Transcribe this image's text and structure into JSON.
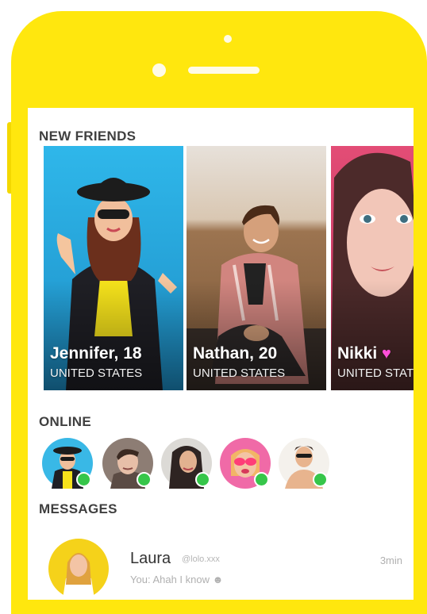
{
  "sections": {
    "new_friends": "NEW FRIENDS",
    "online": "ONLINE",
    "messages": "MESSAGES"
  },
  "new_friends": [
    {
      "name": "Jennifer, 18",
      "country": "UNITED STATES"
    },
    {
      "name": "Nathan, 20",
      "country": "UNITED STATES"
    },
    {
      "name": "Nikki",
      "country": "UNITED STATES",
      "icon": "heart-icon"
    }
  ],
  "online_users": [
    {
      "icon": "avatar-woman-hat",
      "status": "online"
    },
    {
      "icon": "avatar-man",
      "status": "online"
    },
    {
      "icon": "avatar-woman-dark-hair",
      "status": "online"
    },
    {
      "icon": "avatar-woman-pink-glasses",
      "status": "online"
    },
    {
      "icon": "avatar-man-sunglasses",
      "status": "online"
    }
  ],
  "messages": [
    {
      "name": "Laura",
      "handle": "@lolo.xxx",
      "time": "3min",
      "preview": "You: Ahah I know"
    }
  ],
  "colors": {
    "phone_body": "#ffe70e",
    "online_dot": "#36c64a",
    "card_blue": "#3bbcec",
    "card_pink": "#e0446d"
  }
}
